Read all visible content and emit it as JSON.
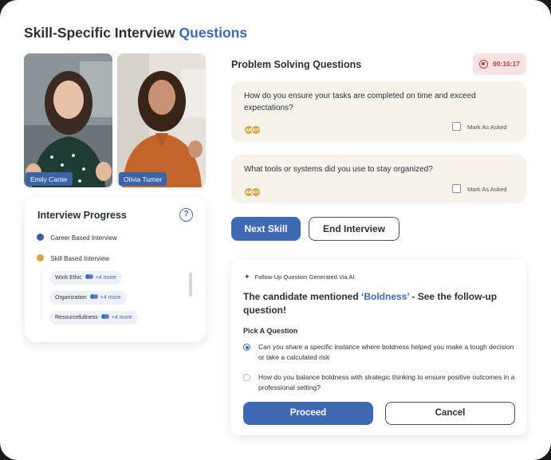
{
  "page": {
    "title_main": "Skill-Specific Interview",
    "title_accent": "Questions"
  },
  "participants": [
    {
      "name": "Emily Carter"
    },
    {
      "name": "Olivia Turner"
    }
  ],
  "progress": {
    "title": "Interview Progress",
    "help_symbol": "?",
    "steps": [
      {
        "label": "Career Based Interview",
        "color": "#3d5c9c"
      },
      {
        "label": "Skill Based Interview",
        "color": "#d6a545"
      }
    ],
    "skills": [
      {
        "label": "Work Ethic",
        "more": "+4 more"
      },
      {
        "label": "Organization",
        "more": "+4 more"
      },
      {
        "label": "Resourcefullness",
        "more": "+4 more"
      }
    ]
  },
  "questions_section": {
    "title": "Problem Solving Questions",
    "timer": "00:10:17",
    "questions": [
      {
        "text": "How do you ensure your tasks are completed on time and exceed expectations?",
        "avatars": [
          "AK",
          "KV"
        ],
        "mark_label": "Mark As Asked",
        "marked": false
      },
      {
        "text": "What tools or systems did you use to stay organized?",
        "avatars": [
          "AK",
          "KV"
        ],
        "mark_label": "Mark As Asked",
        "marked": false
      }
    ],
    "next_skill_label": "Next Skill",
    "end_interview_label": "End Interview"
  },
  "follow_up": {
    "tag": "Follow-Up Question Generated Via AI",
    "headline_prefix": "The candidate mentioned ",
    "keyword": "‘Boldness’",
    "headline_suffix": " - See the follow-up question!",
    "pick_label": "Pick  A Question",
    "options": [
      {
        "text": "Can you share a specific instance where boldness helped you make a tough decision or take a calculated risk",
        "selected": true
      },
      {
        "text": "How do you balance boldness with strategic thinking to ensure positive outcomes in a professional setting?",
        "selected": false
      }
    ],
    "proceed_label": "Proceed",
    "cancel_label": "Cancel"
  },
  "colors": {
    "accent": "#3d6ab3",
    "question_card_bg": "#f7f3ea",
    "timer_bg": "#fbe3e3",
    "timer_text": "#c53a3a"
  }
}
